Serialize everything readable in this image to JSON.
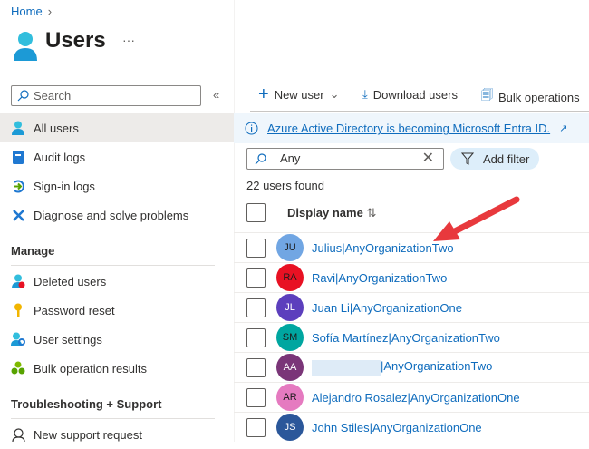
{
  "breadcrumb": {
    "home": "Home"
  },
  "page": {
    "title": "Users",
    "more": "···"
  },
  "sidebar": {
    "search_placeholder": "Search",
    "collapse": "«",
    "items": [
      {
        "label": "All users",
        "icon": "user-icon",
        "selected": true
      },
      {
        "label": "Audit logs",
        "icon": "book-icon"
      },
      {
        "label": "Sign-in logs",
        "icon": "sign-in-icon"
      },
      {
        "label": "Diagnose and solve problems",
        "icon": "wrench-icon"
      }
    ],
    "manage_heading": "Manage",
    "manage_items": [
      {
        "label": "Deleted users",
        "icon": "deleted-user-icon"
      },
      {
        "label": "Password reset",
        "icon": "key-icon"
      },
      {
        "label": "User settings",
        "icon": "user-settings-icon"
      },
      {
        "label": "Bulk operation results",
        "icon": "bulk-results-icon"
      }
    ],
    "support_heading": "Troubleshooting + Support",
    "support_items": [
      {
        "label": "New support request",
        "icon": "support-icon"
      }
    ]
  },
  "toolbar": {
    "new_user": "New user",
    "download": "Download users",
    "bulk": "Bulk operations"
  },
  "banner": {
    "text": "Azure Active Directory is becoming Microsoft Entra ID."
  },
  "filter": {
    "value": "Any",
    "add_filter": "Add filter"
  },
  "results": {
    "count": "22 users found",
    "column": "Display name",
    "sort": "⇅"
  },
  "users": [
    {
      "initials": "JU",
      "name": "Julius|AnyOrganizationTwo",
      "color": "#71a6e3",
      "fg": "#1b1b1b"
    },
    {
      "initials": "RA",
      "name": "Ravi|AnyOrganizationTwo",
      "color": "#e81123",
      "fg": "#1b1b1b"
    },
    {
      "initials": "JL",
      "name": "Juan Li|AnyOrganizationOne",
      "color": "#5c3fbd",
      "fg": "#ffffff"
    },
    {
      "initials": "SM",
      "name": "Sofía Martínez|AnyOrganizationTwo",
      "color": "#00a6a0",
      "fg": "#1b1b1b"
    },
    {
      "initials": "AA",
      "name": "|AnyOrganizationTwo",
      "color": "#7a3578",
      "fg": "#ffffff",
      "redacted": true
    },
    {
      "initials": "AR",
      "name": "Alejandro Rosalez|AnyOrganizationOne",
      "color": "#e57ac0",
      "fg": "#1b1b1b"
    },
    {
      "initials": "JS",
      "name": "John Stiles|AnyOrganizationOne",
      "color": "#2b579a",
      "fg": "#ffffff"
    }
  ],
  "colors": {
    "link": "#0f6cbd",
    "arrow": "#e8393d"
  }
}
